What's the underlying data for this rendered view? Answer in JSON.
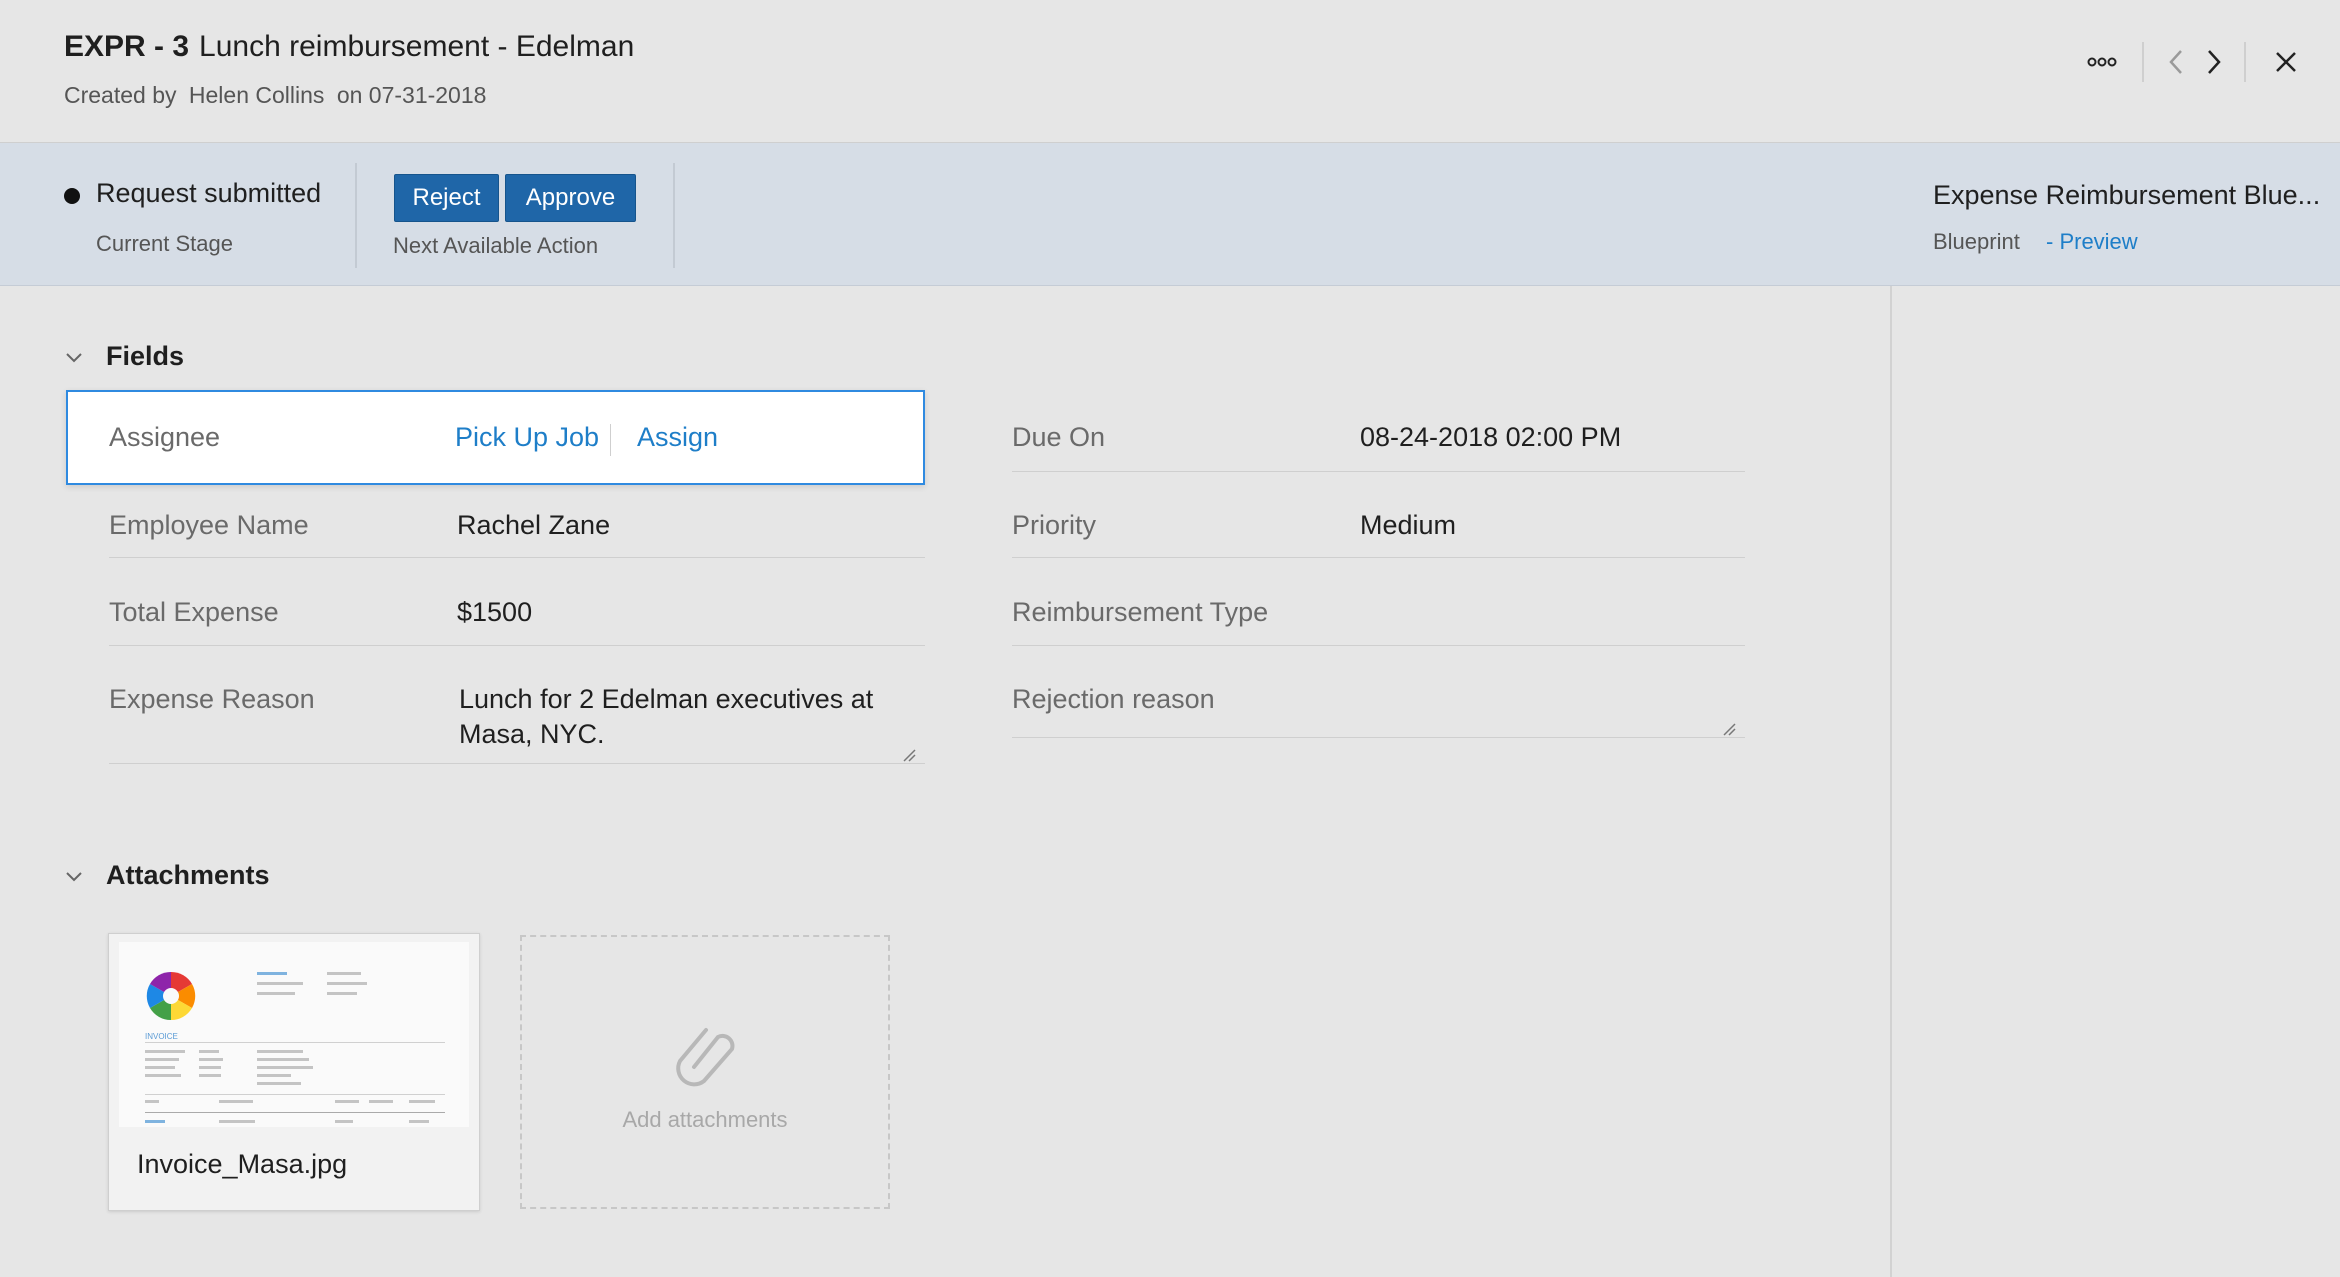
{
  "header": {
    "record_id": "EXPR - 3",
    "record_title": "Lunch reimbursement - Edelman",
    "created_by_prefix": "Created by",
    "created_by_name": "Helen Collins",
    "created_on": "on 07-31-2018"
  },
  "blueprint_bar": {
    "current_stage": "Request submitted",
    "current_stage_label": "Current Stage",
    "actions": [
      {
        "label": "Reject"
      },
      {
        "label": "Approve"
      }
    ],
    "next_action_label": "Next Available Action",
    "blueprint_name": "Expense Reimbursement Blue...",
    "blueprint_label": "Blueprint",
    "preview_link": "- Preview"
  },
  "fields_section": {
    "title": "Fields",
    "left": [
      {
        "label": "Assignee",
        "links": [
          "Pick Up Job",
          "Assign"
        ]
      },
      {
        "label": "Employee Name",
        "value": "Rachel Zane"
      },
      {
        "label": "Total Expense",
        "value": "$1500"
      },
      {
        "label": "Expense Reason",
        "value": "Lunch for 2 Edelman executives at Masa, NYC."
      }
    ],
    "right": [
      {
        "label": "Due On",
        "value": "08-24-2018 02:00 PM"
      },
      {
        "label": "Priority",
        "value": "Medium"
      },
      {
        "label": "Reimbursement Type",
        "value": ""
      },
      {
        "label": "Rejection reason",
        "value": ""
      }
    ]
  },
  "attachments_section": {
    "title": "Attachments",
    "items": [
      {
        "file_name": "Invoice_Masa.jpg",
        "thumb_heading": "INVOICE"
      }
    ],
    "add_label": "Add attachments"
  },
  "icons": {
    "more": "more-icon",
    "prev": "chevron-left-icon",
    "next": "chevron-right-icon",
    "close": "close-icon",
    "collapse": "chevron-down-icon",
    "attach": "paperclip-icon"
  },
  "colors": {
    "accent": "#1e7ec8",
    "primary_button": "#1f66a8",
    "blueprint_bar": "#d6dde6",
    "background": "#e6e6e6"
  }
}
